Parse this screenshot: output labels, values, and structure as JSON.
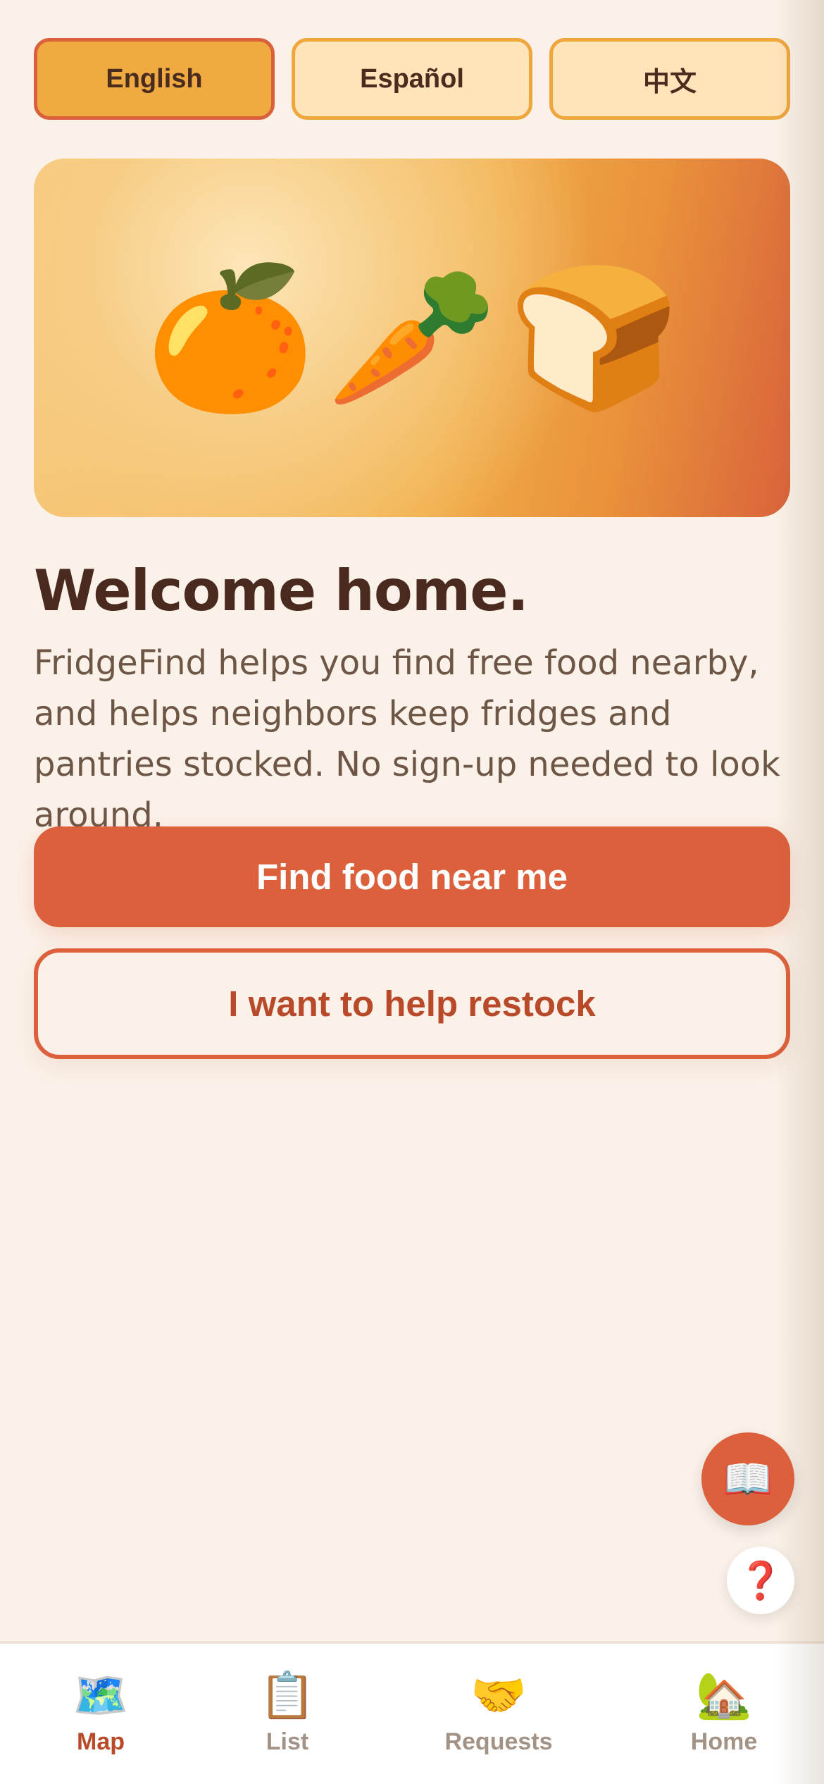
{
  "languages": [
    {
      "label": "English",
      "active": true
    },
    {
      "label": "Español",
      "active": false
    },
    {
      "label": "中文",
      "active": false
    }
  ],
  "hero": {
    "icons": [
      "🍊",
      "🥕",
      "🍞"
    ],
    "icon_names": [
      "orange-icon",
      "carrot-icon",
      "bread-icon"
    ]
  },
  "welcome": {
    "title": "Welcome home.",
    "body": "FridgeFind helps you find free food nearby, and helps neighbors keep fridges and pantries stocked. No sign-up needed to look around."
  },
  "actions": {
    "primary_label": "Find food near me",
    "secondary_label": "I want to help restock"
  },
  "fabs": {
    "guide_icon": "📖",
    "help_icon": "❓"
  },
  "tabs": [
    {
      "label": "Map",
      "icon": "🗺️",
      "active": true
    },
    {
      "label": "List",
      "icon": "📋",
      "active": false
    },
    {
      "label": "Requests",
      "icon": "🤝",
      "active": false
    },
    {
      "label": "Home",
      "icon": "🏡",
      "active": false
    }
  ],
  "colors": {
    "background": "#faf1e8",
    "accent": "#dc603b",
    "accent_text": "#b84a2a",
    "language_active": "#f0aa42",
    "language_inactive": "#fde4b9",
    "heading": "#4a2a1f",
    "body_text": "#6e5647",
    "tab_inactive": "#a39387"
  }
}
